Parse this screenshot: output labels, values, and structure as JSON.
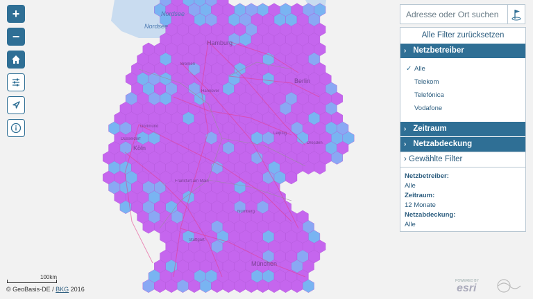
{
  "map": {
    "sea_labels": [
      "Nordsee",
      "Nordsee"
    ],
    "cities": [
      {
        "name": "Hamburg"
      },
      {
        "name": "Bremen"
      },
      {
        "name": "Hannover"
      },
      {
        "name": "Berlin"
      },
      {
        "name": "Dortmund"
      },
      {
        "name": "Düsseldorf"
      },
      {
        "name": "Köln"
      },
      {
        "name": "Leipzig"
      },
      {
        "name": "Dresden"
      },
      {
        "name": "Frankfurt am Main"
      },
      {
        "name": "Nürnberg"
      },
      {
        "name": "Stuttgart"
      },
      {
        "name": "München"
      }
    ],
    "colors": {
      "coverage": "#c566ee",
      "good": "#8aa8f4",
      "weak": "#79b4f2",
      "road": "#e33a8a",
      "sea": "#c9dcf0",
      "border": "#8a8a8a"
    }
  },
  "controls": {
    "zoom_in": "+",
    "zoom_out": "−",
    "icons": [
      "plus-icon",
      "minus-icon",
      "home-icon",
      "sliders-icon",
      "navigation-arrow-icon",
      "info-icon"
    ]
  },
  "search": {
    "placeholder": "Adresse oder Ort suchen",
    "icon": "location-pin-icon"
  },
  "filter": {
    "reset": "Alle Filter zurücksetzen",
    "netzbetreiber": {
      "title": "Netzbetreiber",
      "options": [
        {
          "label": "Alle",
          "checked": true
        },
        {
          "label": "Telekom",
          "checked": false
        },
        {
          "label": "Telefónica",
          "checked": false
        },
        {
          "label": "Vodafone",
          "checked": false
        }
      ]
    },
    "zeitraum": "Zeitraum",
    "netzabdeckung": "Netzabdeckung",
    "gewaehlte": "Gewählte Filter",
    "summary": [
      {
        "label": "Netzbetreiber:",
        "value": "Alle"
      },
      {
        "label": "Zeitraum:",
        "value": "12 Monate"
      },
      {
        "label": "Netzabdeckung:",
        "value": "Alle"
      }
    ]
  },
  "footer": {
    "copyright_prefix": "© GeoBasis-DE / ",
    "copyright_link": "BKG",
    "copyright_suffix": " 2016",
    "scale": "100km",
    "logo_text": "esri",
    "logo_small": "POWERED BY"
  }
}
